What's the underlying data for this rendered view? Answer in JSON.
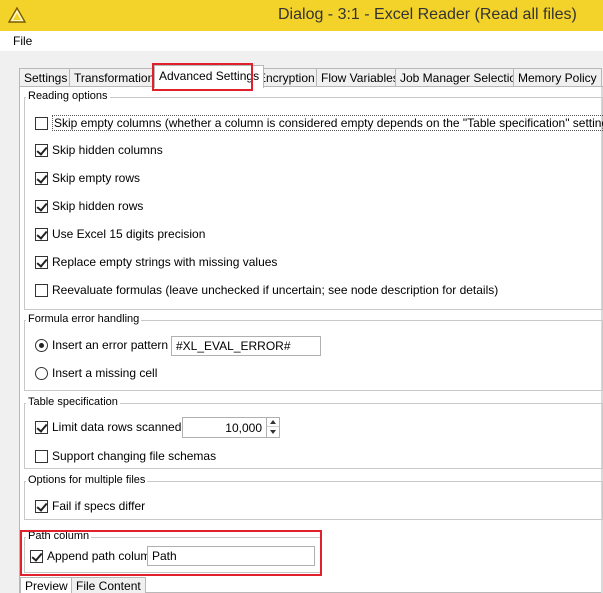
{
  "window": {
    "title": "Dialog - 3:1 - Excel Reader (Read all files)",
    "icon": "knime-triangle-icon",
    "accent_color": "#f3d22a"
  },
  "menu": {
    "items": [
      {
        "label": "File"
      }
    ]
  },
  "tabs": [
    {
      "label": "Settings",
      "active": false
    },
    {
      "label": "Transformation",
      "active": false
    },
    {
      "label": "Advanced Settings",
      "active": true
    },
    {
      "label": "Encryption",
      "active": false
    },
    {
      "label": "Flow Variables",
      "active": false
    },
    {
      "label": "Job Manager Selection",
      "active": false
    },
    {
      "label": "Memory Policy",
      "active": false
    }
  ],
  "highlight_color": "#e0202a",
  "reading_options": {
    "title": "Reading options",
    "options": [
      {
        "label": "Skip empty columns (whether a column is considered empty depends on the \"Table specification\" settings below)",
        "checked": false
      },
      {
        "label": "Skip hidden columns",
        "checked": true
      },
      {
        "label": "Skip empty rows",
        "checked": true
      },
      {
        "label": "Skip hidden rows",
        "checked": true
      },
      {
        "label": "Use Excel 15 digits precision",
        "checked": true
      },
      {
        "label": "Replace empty strings with missing values",
        "checked": true
      },
      {
        "label": "Reevaluate formulas (leave unchecked if uncertain; see node description for details)",
        "checked": false
      }
    ]
  },
  "formula_error": {
    "title": "Formula error handling",
    "insert_pattern_label": "Insert an error pattern",
    "insert_pattern_selected": true,
    "pattern_value": "#XL_EVAL_ERROR#",
    "missing_cell_label": "Insert a missing cell",
    "missing_cell_selected": false
  },
  "table_spec": {
    "title": "Table specification",
    "limit_rows_label": "Limit data rows scanned",
    "limit_rows_checked": true,
    "limit_rows_value": "10,000",
    "support_changing_label": "Support changing file schemas",
    "support_changing_checked": false
  },
  "multiple_files": {
    "title": "Options for multiple files",
    "fail_label": "Fail if specs differ",
    "fail_checked": true
  },
  "path_column": {
    "title": "Path column",
    "append_label": "Append path column",
    "append_checked": true,
    "column_name": "Path"
  },
  "bottom_tabs": [
    {
      "label": "Preview",
      "active": true
    },
    {
      "label": "File Content",
      "active": false
    }
  ]
}
